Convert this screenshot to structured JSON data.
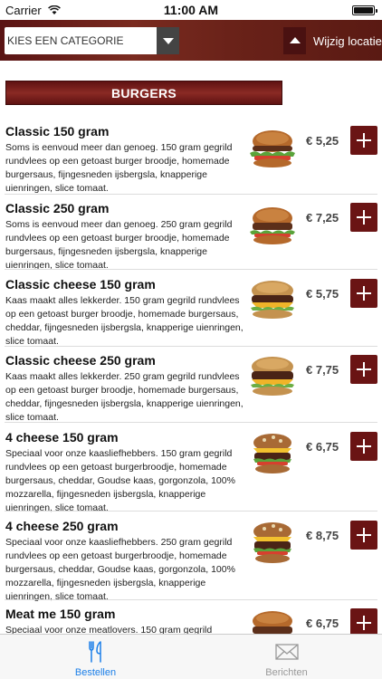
{
  "status_bar": {
    "carrier": "Carrier",
    "time": "11:00 AM"
  },
  "header": {
    "category_select": "KIES EEN CATEGORIE",
    "location_label": "Wijzig locatie"
  },
  "section": {
    "title": "BURGERS"
  },
  "items": [
    {
      "name": "Classic 150 gram",
      "description": "Soms is eenvoud meer dan genoeg. 150 gram gegrild rundvlees op een getoast burger broodje, homemade burgersaus, fijngesneden ijsbergsla, knapperige uienringen, slice tomaat.",
      "price": "€ 5,25",
      "image_icon": "classic-burger-image"
    },
    {
      "name": "Classic 250 gram",
      "description": "Soms is eenvoud meer dan genoeg. 250 gram gegrild rundvlees op een getoast burger broodje, homemade burgersaus, fijngesneden ijsbergsla, knapperige uienringen, slice tomaat.",
      "price": "€ 7,25",
      "image_icon": "classic-burger-image"
    },
    {
      "name": "Classic cheese 150 gram",
      "description": "Kaas maakt alles lekkerder. 150 gram gegrild rundvlees op een getoast burger broodje, homemade burgersaus, cheddar, fijngesneden ijsbergsla, knapperige uienringen, slice tomaat.",
      "price": "€ 5,75",
      "image_icon": "cheese-burger-image"
    },
    {
      "name": "Classic cheese 250 gram",
      "description": "Kaas maakt alles lekkerder. 250 gram gegrild rundvlees op een getoast burger broodje, homemade burgersaus, cheddar, fijngesneden ijsbergsla, knapperige uienringen, slice tomaat.",
      "price": "€ 7,75",
      "image_icon": "cheese-burger-image"
    },
    {
      "name": "4 cheese 150 gram",
      "description": "Speciaal voor onze kaasliefhebbers. 150 gram gegrild rundvlees op een getoast burgerbroodje, homemade burgersaus, cheddar, Goudse kaas, gorgonzola, 100% mozzarella, fijngesneden ijsbergsla, knapperige uienringen, slice tomaat.",
      "price": "€ 6,75",
      "image_icon": "four-cheese-burger-image"
    },
    {
      "name": "4 cheese 250 gram",
      "description": "Speciaal voor onze kaasliefhebbers. 250 gram gegrild rundvlees op een getoast burgerbroodje, homemade burgersaus, cheddar, Goudse kaas, gorgonzola, 100% mozzarella, fijngesneden ijsbergsla, knapperige uienringen, slice tomaat.",
      "price": "€ 8,75",
      "image_icon": "four-cheese-burger-image"
    },
    {
      "name": "Meat me 150 gram",
      "description": "Speciaal voor onze meatlovers. 150 gram gegrild",
      "price": "€ 6,75",
      "image_icon": "meat-burger-image"
    }
  ],
  "tab_bar": {
    "tabs": [
      {
        "label": "Bestellen",
        "icon": "fork-knife-icon",
        "active": true,
        "color": "#1a7ee8"
      },
      {
        "label": "Berichten",
        "icon": "envelope-icon",
        "active": false,
        "color": "#999999"
      }
    ]
  },
  "colors": {
    "accent": "#6a1414",
    "tab_active": "#1a7ee8",
    "tab_inactive": "#999999"
  }
}
